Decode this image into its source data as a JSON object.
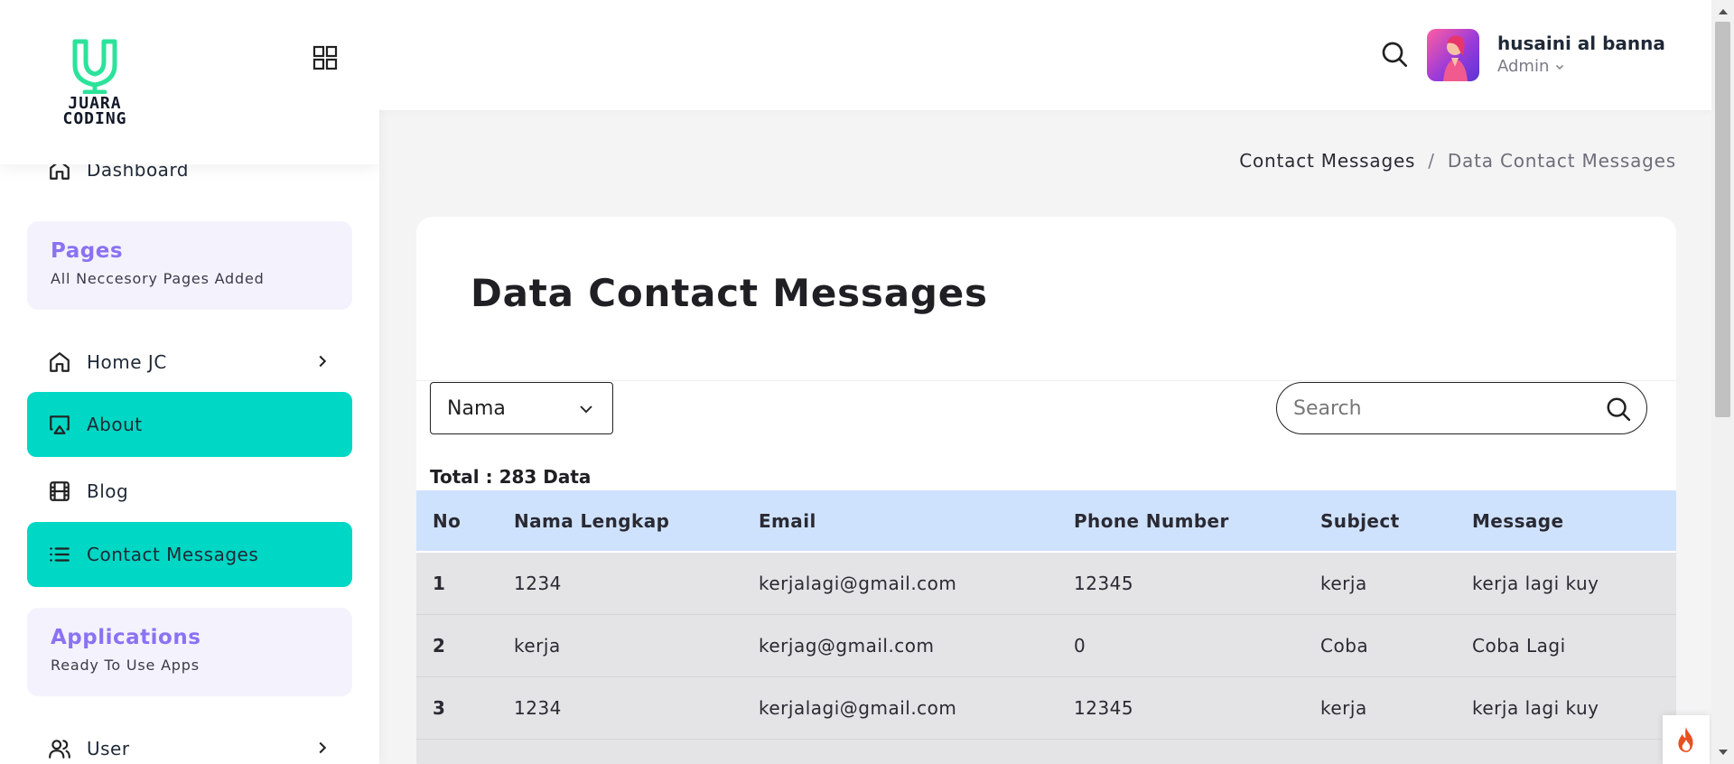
{
  "brand": {
    "logo_text_1": "JUARA",
    "logo_text_2": "CODING",
    "logo_color": "#2be39a"
  },
  "sidebar": {
    "items": [
      {
        "label": "Dashboard",
        "icon": "home-icon"
      },
      {
        "label": "Home JC",
        "icon": "home-icon",
        "has_submenu": true
      },
      {
        "label": "About",
        "icon": "airplay-icon",
        "active": true
      },
      {
        "label": "Blog",
        "icon": "film-icon"
      },
      {
        "label": "Contact Messages",
        "icon": "list-icon",
        "active": true
      },
      {
        "label": "User",
        "icon": "users-icon",
        "has_submenu": true
      }
    ],
    "sections": [
      {
        "title": "Pages",
        "subtitle": "All Neccesory Pages Added"
      },
      {
        "title": "Applications",
        "subtitle": "Ready To Use Apps"
      }
    ],
    "active_color": "#00d7c4",
    "section_title_color": "#8b72f3"
  },
  "header": {
    "user_name": "husaini al banna",
    "user_role": "Admin"
  },
  "breadcrumb": {
    "parent": "Contact Messages",
    "separator": "/",
    "current": "Data Contact Messages"
  },
  "main": {
    "title": "Data Contact Messages",
    "filter_selected": "Nama",
    "search_placeholder": "Search",
    "total_label": "Total : 283 Data",
    "table": {
      "columns": [
        "No",
        "Nama Lengkap",
        "Email",
        "Phone Number",
        "Subject",
        "Message"
      ],
      "rows": [
        [
          "1",
          "1234",
          "kerjalagi@gmail.com",
          "12345",
          "kerja",
          "kerja lagi kuy"
        ],
        [
          "2",
          "kerja",
          "kerjag@gmail.com",
          "0",
          "Coba",
          "Coba Lagi"
        ],
        [
          "3",
          "1234",
          "kerjalagi@gmail.com",
          "12345",
          "kerja",
          "kerja lagi kuy"
        ],
        [
          "",
          "",
          "",
          "",
          "",
          ""
        ]
      ]
    },
    "header_row_color": "#cfe2fd",
    "body_row_color": "#e4e4e6"
  }
}
